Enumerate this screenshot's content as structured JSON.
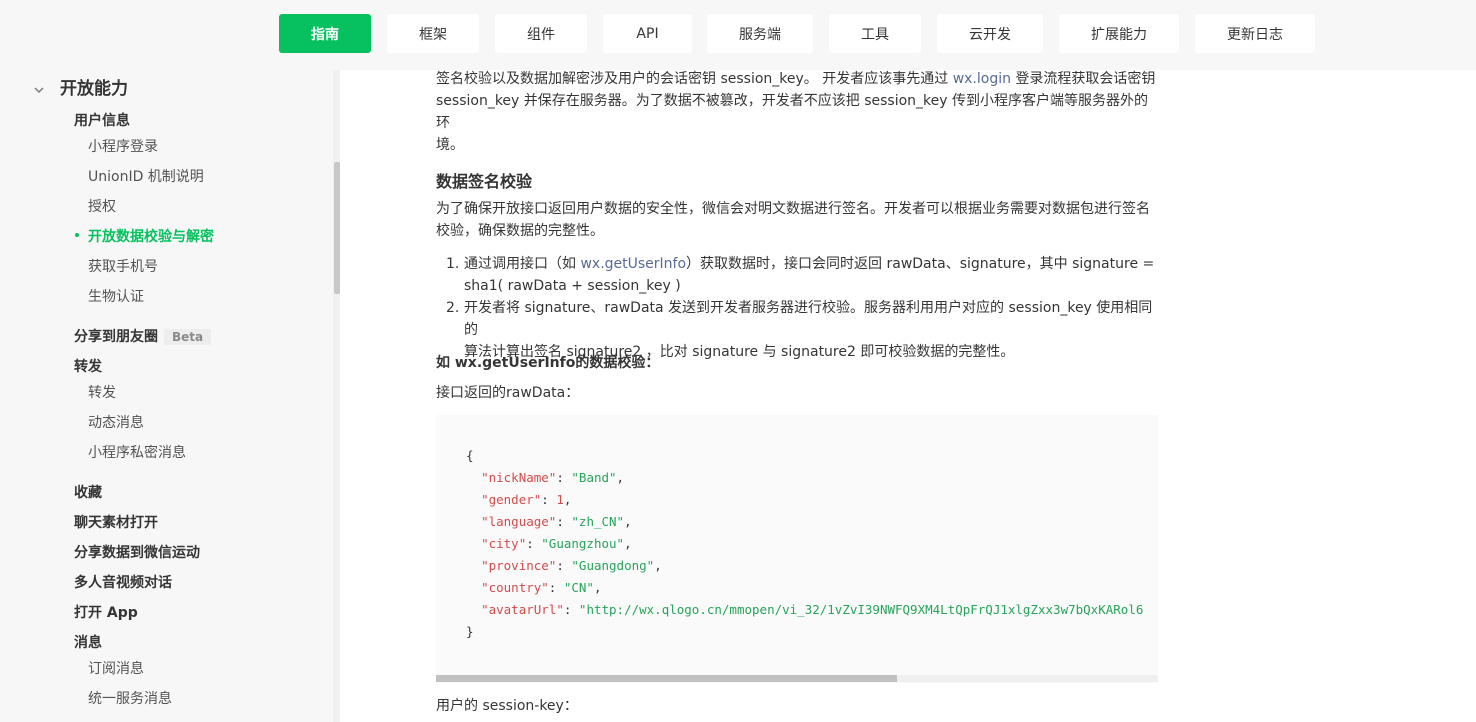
{
  "nav": {
    "tabs": [
      "指南",
      "框架",
      "组件",
      "API",
      "服务端",
      "工具",
      "云开发",
      "扩展能力",
      "更新日志"
    ],
    "active": "指南"
  },
  "sidebar": {
    "section_title": "开放能力",
    "user_info": {
      "group": "用户信息",
      "items": [
        "小程序登录",
        "UnionID 机制说明",
        "授权",
        "开放数据校验与解密",
        "获取手机号",
        "生物认证"
      ],
      "active_item": "开放数据校验与解密"
    },
    "share_moments": {
      "label": "分享到朋友圈",
      "badge": "Beta"
    },
    "forward": {
      "group": "转发",
      "items": [
        "转发",
        "动态消息",
        "小程序私密消息"
      ]
    },
    "groups_more": [
      "收藏",
      "聊天素材打开",
      "分享数据到微信运动",
      "多人音视频对话",
      "打开 App"
    ],
    "message": {
      "group": "消息",
      "items": [
        "订阅消息",
        "统一服务消息"
      ]
    }
  },
  "content": {
    "intro": {
      "line1_a": "签名校验以及数据加解密涉及用户的会话密钥 session_key。 开发者应该事先通过 ",
      "line1_link": "wx.login",
      "line1_b": " 登录流程获取会话密钥",
      "line2": "session_key 并保存在服务器。为了数据不被篡改，开发者不应该把 session_key 传到小程序客户端等服务器外的环",
      "line3": "境。"
    },
    "heading": "数据签名校验",
    "para": {
      "line1": "为了确保开放接口返回用户数据的安全性，微信会对明文数据进行签名。开发者可以根据业务需要对数据包进行签名",
      "line2": "校验，确保数据的完整性。"
    },
    "steps": [
      {
        "num": "1.",
        "a": "通过调用接口（如 ",
        "link": "wx.getUserInfo",
        "b": "）获取数据时，接口会同时返回 rawData、signature，其中 signature =",
        "c": "sha1( rawData + session_key )"
      },
      {
        "num": "2.",
        "a": "开发者将 signature、rawData 发送到开发者服务器进行校验。服务器利用用户对应的 session_key 使用相同的",
        "c": "算法计算出签名 signature2 ，比对 signature 与 signature2 即可校验数据的完整性。"
      }
    ],
    "example_title": "如 wx.getUserInfo的数据校验：",
    "rawdata_label": "接口返回的rawData：",
    "code": {
      "open": "{",
      "lines": [
        {
          "key": "\"nickName\"",
          "val": "\"Band\"",
          "type": "s",
          "tail": ","
        },
        {
          "key": "\"gender\"",
          "val": "1",
          "type": "n",
          "tail": ","
        },
        {
          "key": "\"language\"",
          "val": "\"zh_CN\"",
          "type": "s",
          "tail": ","
        },
        {
          "key": "\"city\"",
          "val": "\"Guangzhou\"",
          "type": "s",
          "tail": ","
        },
        {
          "key": "\"province\"",
          "val": "\"Guangdong\"",
          "type": "s",
          "tail": ","
        },
        {
          "key": "\"country\"",
          "val": "\"CN\"",
          "type": "s",
          "tail": ","
        },
        {
          "key": "\"avatarUrl\"",
          "val": "\"http://wx.qlogo.cn/mmopen/vi_32/1vZvI39NWFQ9XM4LtQpFrQJ1xlgZxx3w7bQxKARol6",
          "type": "s",
          "tail": ""
        }
      ],
      "close": "}"
    },
    "session_label": "用户的 session-key："
  },
  "colors": {
    "accent": "#07c160",
    "link": "#576b95",
    "code_key": "#d14c4c",
    "code_string": "#27a35a"
  }
}
